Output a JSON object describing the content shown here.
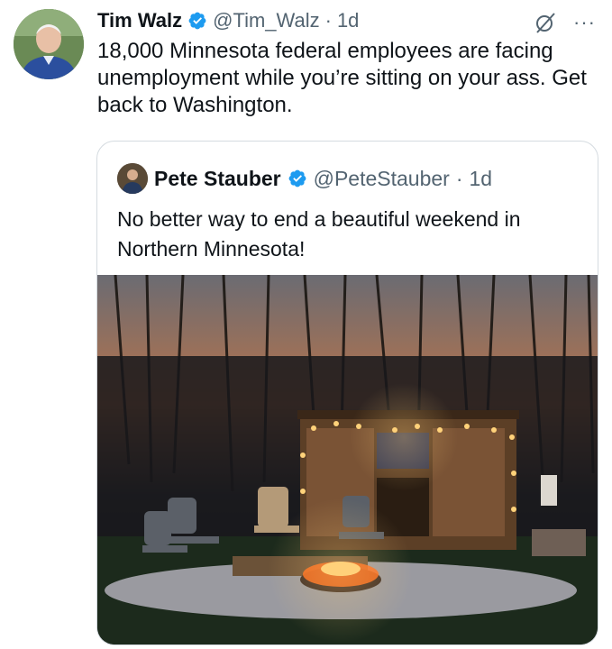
{
  "tweet": {
    "author_name": "Tim Walz",
    "author_handle": "@Tim_Walz",
    "separator": "·",
    "time": "1d",
    "text": "18,000 Minnesota federal employees are facing unemployment while you’re sitting on your ass. Get back to Washington.",
    "more_label": "···"
  },
  "quote": {
    "author_name": "Pete Stauber",
    "author_handle": "@PeteStauber",
    "separator": "·",
    "time": "1d",
    "text": "No better way to end a beautiful weekend in Northern Minnesota!"
  },
  "icons": {
    "verified": "verified-badge-icon",
    "grok": "grok-icon",
    "more": "more-options-icon"
  },
  "colors": {
    "verified_blue": "#1d9bf0",
    "text_primary": "#0f1419",
    "text_secondary": "#536471",
    "card_border": "#d5dbe0"
  }
}
